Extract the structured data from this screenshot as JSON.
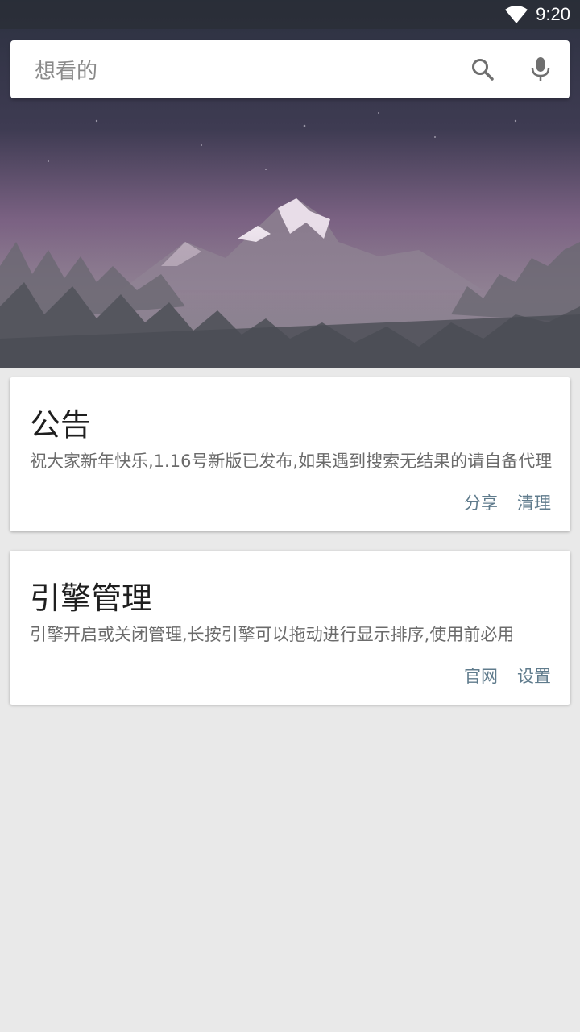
{
  "status_bar": {
    "time": "9:20"
  },
  "search": {
    "placeholder": "想看的",
    "search_icon": "search-icon",
    "mic_icon": "microphone-icon"
  },
  "announcement": {
    "title": "公告",
    "text": "祝大家新年快乐,1.16号新版已发布,如果遇到搜索无结果的请自备代理",
    "actions": [
      "分享",
      "清理"
    ]
  },
  "engine": {
    "title": "引擎管理",
    "text": "引擎开启或关闭管理,长按引擎可以拖动进行显示排序,使用前必用",
    "actions": [
      "官网",
      "设置"
    ]
  },
  "colors": {
    "background": "#e9e9e9",
    "accent": "#5f7b8c",
    "card": "#ffffff"
  }
}
